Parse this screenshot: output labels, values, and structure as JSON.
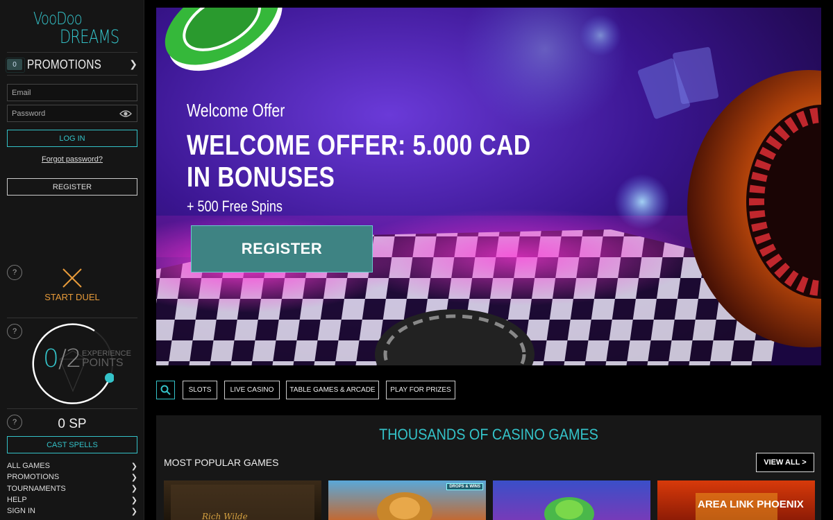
{
  "brand": {
    "logo_line1": "VooDoo",
    "logo_line2": "DREAMS",
    "accent": "#34c3c9"
  },
  "sidebar": {
    "promotions": {
      "count": "0",
      "label": "PROMOTIONS"
    },
    "login": {
      "email_placeholder": "Email",
      "password_placeholder": "Password",
      "login_label": "LOG IN",
      "forgot_label": "Forgot password?",
      "register_label": "REGISTER"
    },
    "duel": {
      "help": "?",
      "label": "START DUEL"
    },
    "experience": {
      "help": "?",
      "current": "0",
      "slash": "/",
      "target": "2",
      "label_line1": "EXPERIENCE",
      "label_line2": "POINTS"
    },
    "spells": {
      "help": "?",
      "sp_value": "0 SP",
      "cast_label": "CAST SPELLS"
    },
    "nav": [
      {
        "label": "ALL GAMES"
      },
      {
        "label": "PROMOTIONS"
      },
      {
        "label": "TOURNAMENTS"
      },
      {
        "label": "HELP"
      },
      {
        "label": "SIGN IN"
      }
    ]
  },
  "hero": {
    "subtitle": "Welcome Offer",
    "title_line1": "WELCOME OFFER: 5.000 CAD",
    "title_line2": "IN BONUSES",
    "spins": "+ 500 Free Spins",
    "cta": "REGISTER"
  },
  "categories": [
    {
      "label": "SLOTS"
    },
    {
      "label": "LIVE CASINO"
    },
    {
      "label": "TABLE GAMES & ARCADE"
    },
    {
      "label": "PLAY FOR PRIZES"
    }
  ],
  "games": {
    "heading": "THOUSANDS OF CASINO GAMES",
    "section_label": "MOST POPULAR GAMES",
    "view_all": "VIEW ALL  >",
    "thumbs": [
      {
        "tag": "",
        "caption": ""
      },
      {
        "tag": "DROPS & WINS",
        "caption": ""
      },
      {
        "tag": "",
        "caption": ""
      },
      {
        "tag": "",
        "caption": "AREA LINK PHOENIX"
      }
    ]
  }
}
